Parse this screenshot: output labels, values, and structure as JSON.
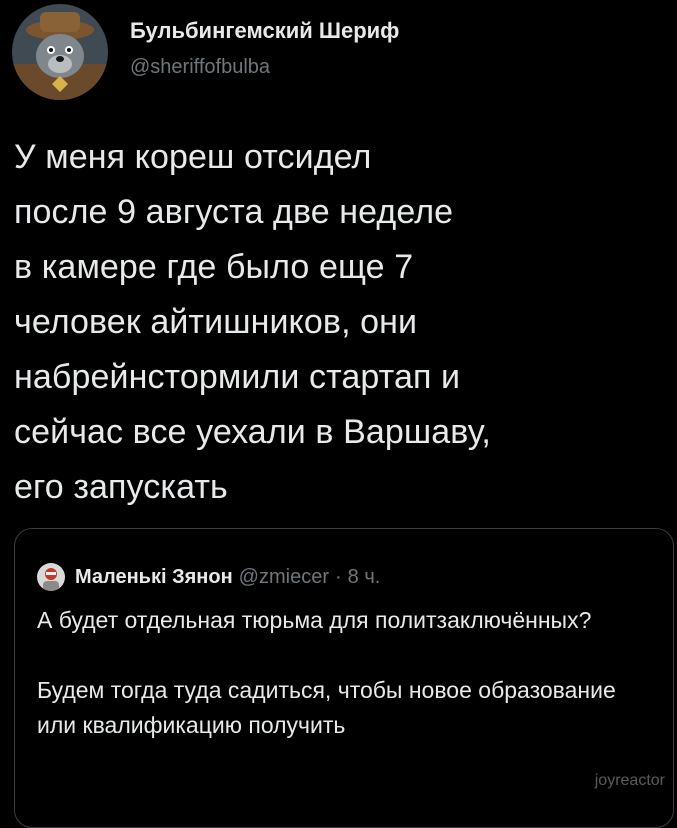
{
  "tweet": {
    "author": {
      "display_name": "Бульбингемский Шериф",
      "handle": "@sheriffofbulba",
      "avatar_icon": "sheriff-avatar-icon"
    },
    "text": "У меня кореш отсидел\nпосле 9 августа две неделе\nв камере где было еще 7\nчеловек айтишников, они\nнабрейнстормили стартап и\nсейчас все уехали в Варшаву,\nего запускать"
  },
  "quoted_tweet": {
    "author": {
      "display_name": "Маленькі Зянон",
      "handle": "@zmiecer",
      "avatar_icon": "zianon-avatar-icon"
    },
    "separator": "·",
    "time": "8 ч.",
    "paragraphs": [
      "А будет отдельная тюрьма для политзаключённых?",
      "Будем тогда туда садиться, чтобы новое образование или квалификацию получить"
    ]
  },
  "watermark": "joyreactor",
  "colors": {
    "background": "#000000",
    "text_primary": "#e7e9ea",
    "text_secondary": "#71767b",
    "border": "#3a3d41"
  }
}
